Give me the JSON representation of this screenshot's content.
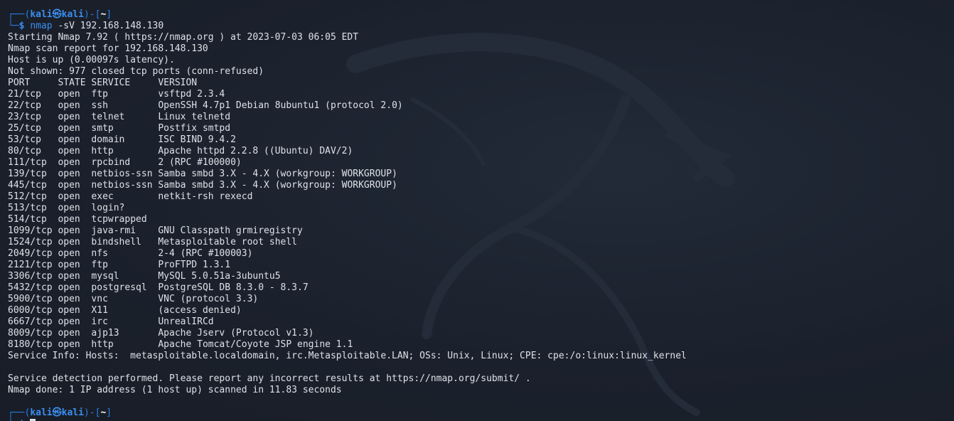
{
  "prompt": {
    "user": "kali",
    "host": "kali",
    "skull": "㉿",
    "dir": "~",
    "symbol": "$"
  },
  "command": {
    "name": "nmap",
    "args": " -sV 192.168.148.130"
  },
  "output_header": [
    "Starting Nmap 7.92 ( https://nmap.org ) at 2023-07-03 06:05 EDT",
    "Nmap scan report for 192.168.148.130",
    "Host is up (0.00097s latency).",
    "Not shown: 977 closed tcp ports (conn-refused)"
  ],
  "table": {
    "columns": [
      "PORT",
      "STATE",
      "SERVICE",
      "VERSION"
    ],
    "rows": [
      [
        "21/tcp",
        "open",
        "ftp",
        "vsftpd 2.3.4"
      ],
      [
        "22/tcp",
        "open",
        "ssh",
        "OpenSSH 4.7p1 Debian 8ubuntu1 (protocol 2.0)"
      ],
      [
        "23/tcp",
        "open",
        "telnet",
        "Linux telnetd"
      ],
      [
        "25/tcp",
        "open",
        "smtp",
        "Postfix smtpd"
      ],
      [
        "53/tcp",
        "open",
        "domain",
        "ISC BIND 9.4.2"
      ],
      [
        "80/tcp",
        "open",
        "http",
        "Apache httpd 2.2.8 ((Ubuntu) DAV/2)"
      ],
      [
        "111/tcp",
        "open",
        "rpcbind",
        "2 (RPC #100000)"
      ],
      [
        "139/tcp",
        "open",
        "netbios-ssn",
        "Samba smbd 3.X - 4.X (workgroup: WORKGROUP)"
      ],
      [
        "445/tcp",
        "open",
        "netbios-ssn",
        "Samba smbd 3.X - 4.X (workgroup: WORKGROUP)"
      ],
      [
        "512/tcp",
        "open",
        "exec",
        "netkit-rsh rexecd"
      ],
      [
        "513/tcp",
        "open",
        "login?",
        ""
      ],
      [
        "514/tcp",
        "open",
        "tcpwrapped",
        ""
      ],
      [
        "1099/tcp",
        "open",
        "java-rmi",
        "GNU Classpath grmiregistry"
      ],
      [
        "1524/tcp",
        "open",
        "bindshell",
        "Metasploitable root shell"
      ],
      [
        "2049/tcp",
        "open",
        "nfs",
        "2-4 (RPC #100003)"
      ],
      [
        "2121/tcp",
        "open",
        "ftp",
        "ProFTPD 1.3.1"
      ],
      [
        "3306/tcp",
        "open",
        "mysql",
        "MySQL 5.0.51a-3ubuntu5"
      ],
      [
        "5432/tcp",
        "open",
        "postgresql",
        "PostgreSQL DB 8.3.0 - 8.3.7"
      ],
      [
        "5900/tcp",
        "open",
        "vnc",
        "VNC (protocol 3.3)"
      ],
      [
        "6000/tcp",
        "open",
        "X11",
        "(access denied)"
      ],
      [
        "6667/tcp",
        "open",
        "irc",
        "UnrealIRCd"
      ],
      [
        "8009/tcp",
        "open",
        "ajp13",
        "Apache Jserv (Protocol v1.3)"
      ],
      [
        "8180/tcp",
        "open",
        "http",
        "Apache Tomcat/Coyote JSP engine 1.1"
      ]
    ]
  },
  "service_info": "Service Info: Hosts:  metasploitable.localdomain, irc.Metasploitable.LAN; OSs: Unix, Linux; CPE: cpe:/o:linux:linux_kernel",
  "footer": [
    "Service detection performed. Please report any incorrect results at https://nmap.org/submit/ .",
    "Nmap done: 1 IP address (1 host up) scanned in 11.83 seconds"
  ],
  "colors": {
    "background": "#1b212c",
    "text": "#dde1e8",
    "prompt_blue": "#3b8ef0",
    "prompt_line": "#2a7de1"
  }
}
